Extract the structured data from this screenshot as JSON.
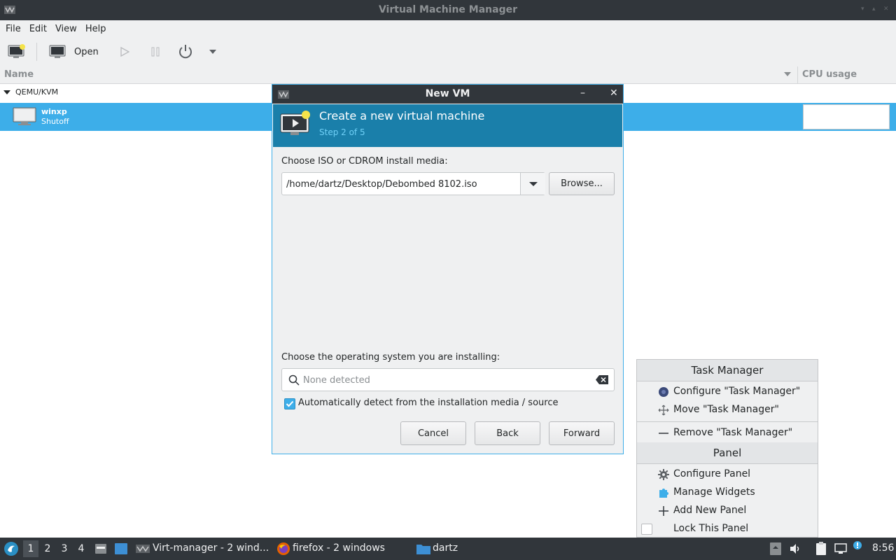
{
  "window": {
    "title": "Virtual Machine Manager"
  },
  "menubar": {
    "items": [
      "File",
      "Edit",
      "View",
      "Help"
    ]
  },
  "toolbar": {
    "open_label": "Open"
  },
  "vm_list": {
    "col_name": "Name",
    "col_cpu": "CPU usage",
    "group": "QEMU/KVM",
    "vms": [
      {
        "name": "winxp",
        "state": "Shutoff"
      }
    ]
  },
  "dialog": {
    "title": "New VM",
    "header_title": "Create a new virtual machine",
    "header_step": "Step 2 of 5",
    "iso_label": "Choose ISO or CDROM install media:",
    "iso_value": "/home/dartz/Desktop/Debombed 8102.iso",
    "browse_label": "Browse...",
    "os_label": "Choose the operating system you are installing:",
    "os_placeholder": "None detected",
    "autodetect_label": "Automatically detect from the installation media / source",
    "autodetect_checked": true,
    "cancel_label": "Cancel",
    "back_label": "Back",
    "forward_label": "Forward"
  },
  "context_menu": {
    "section1": "Task Manager",
    "configure_tm": "Configure \"Task Manager\"",
    "move_tm": "Move \"Task Manager\"",
    "remove_tm": "Remove \"Task Manager\"",
    "section2": "Panel",
    "configure_panel": "Configure Panel",
    "manage_widgets": "Manage Widgets",
    "add_panel": "Add New Panel",
    "lock_panel": "Lock This Panel"
  },
  "taskbar": {
    "desktops": [
      "1",
      "2",
      "3",
      "4"
    ],
    "active_desktop": "1",
    "tasks": [
      {
        "label": "Virt-manager - 2 wind...",
        "icon": "virt-manager-icon"
      },
      {
        "label": "firefox - 2 windows",
        "icon": "firefox-icon"
      },
      {
        "label": "dartz",
        "icon": "folder-icon"
      }
    ],
    "clock": "8:56"
  },
  "colors": {
    "accent": "#3daee9",
    "header_bg": "#1a7faa",
    "titlebar_bg": "#31363b"
  }
}
